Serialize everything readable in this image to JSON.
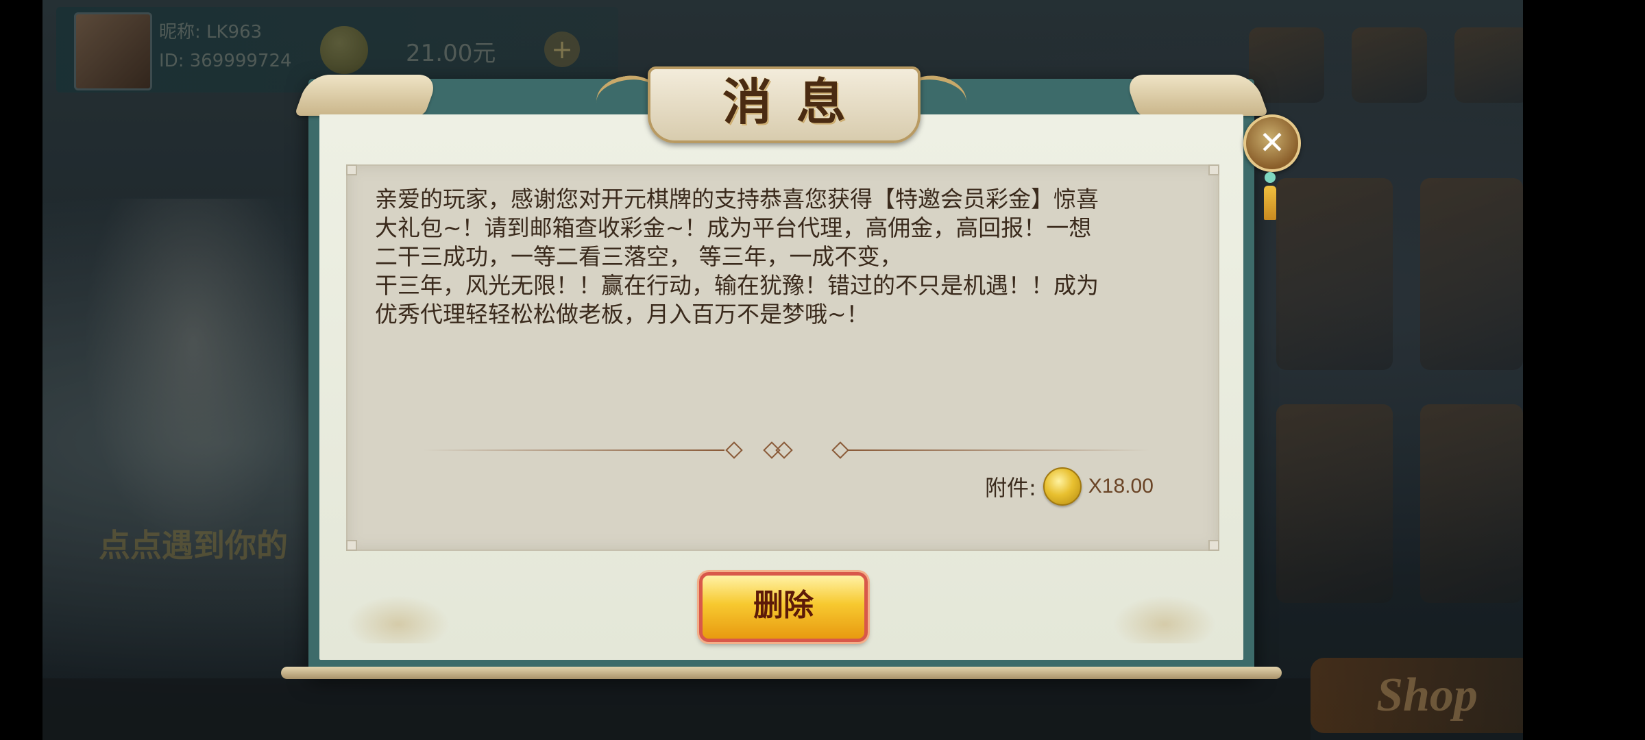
{
  "background": {
    "top_bar": {
      "player_name": "昵称: LK963",
      "player_id": "ID: 369999724",
      "balance": "21.00元",
      "add_symbol": "+"
    },
    "side_caption": "点点遇到你的",
    "shop_label": "Shop"
  },
  "dialog": {
    "title": "消息",
    "close_symbol": "✕",
    "message": "亲爱的玩家，感谢您对开元棋牌的支持恭喜您获得【特邀会员彩金】惊喜\n大礼包~！请到邮箱查收彩金~！成为平台代理，高佣金，高回报！一想\n二干三成功，一等二看三落空， 等三年，一成不变，\n干三年，风光无限！！赢在行动，输在犹豫！错过的不只是机遇！！成为\n优秀代理轻轻松松做老板，月入百万不是梦哦~！",
    "attachment": {
      "label": "附件:",
      "icon": "gold-coin-icon",
      "amount": "X18.00"
    },
    "delete_button": "删除"
  },
  "colors": {
    "panel_frame": "#3d6b6a",
    "panel_paper": "#e4e7d8",
    "message_box": "#d7d3c5",
    "button_gold": "#f7c930",
    "button_border": "#d8584a",
    "text_dark": "#3a2a1c"
  }
}
